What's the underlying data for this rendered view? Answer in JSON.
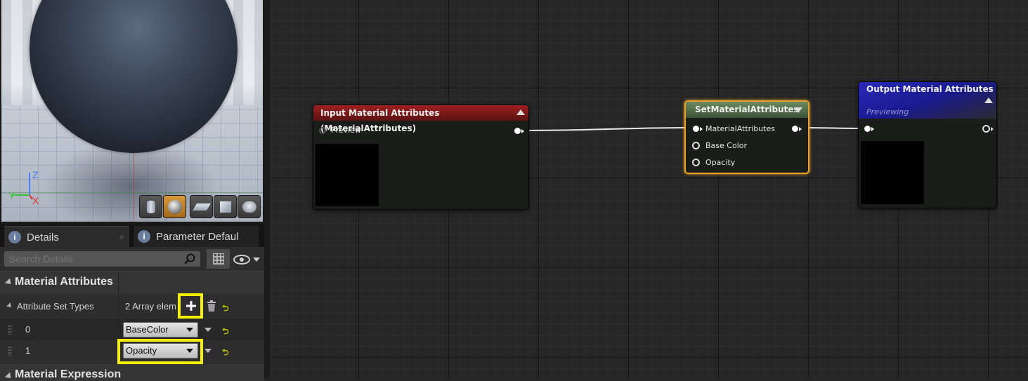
{
  "viewport": {
    "axis_labels": {
      "z": "Z",
      "y": "Y",
      "x": "X"
    },
    "toolbar_icons": [
      "cylinder-preview-icon",
      "sphere-preview-icon",
      "plane-preview-icon",
      "cube-preview-icon",
      "custom-mesh-preview-icon"
    ],
    "active_preview": "sphere-preview-icon"
  },
  "tabs": {
    "details": "Details",
    "parameter_defaults": "Parameter Defaul"
  },
  "details": {
    "search_placeholder": "Search Details",
    "category": "Material Attributes",
    "attribute_set_types": {
      "label": "Attribute Set Types",
      "value": "2 Array elem"
    },
    "elements": [
      {
        "index": "0",
        "value": "BaseColor"
      },
      {
        "index": "1",
        "value": "Opacity"
      }
    ],
    "next_category": "Material Expression"
  },
  "graph": {
    "input_node": {
      "title": "Input Material Attributes (MaterialAttributes)",
      "header_color": "#8a1c1c",
      "pin": "Preview"
    },
    "set_node": {
      "title": "SetMaterialAttributes",
      "header_color": "#4b6a45",
      "border_color": "#e8a02a",
      "pins": [
        "MaterialAttributes",
        "Base Color",
        "Opacity"
      ]
    },
    "output_node": {
      "title": "Output Material Attributes",
      "subtitle": "Previewing",
      "header_color": "#1c1c9a"
    }
  },
  "colors": {
    "highlight": "#f4ee00",
    "accent_orange": "#d99a3a"
  }
}
